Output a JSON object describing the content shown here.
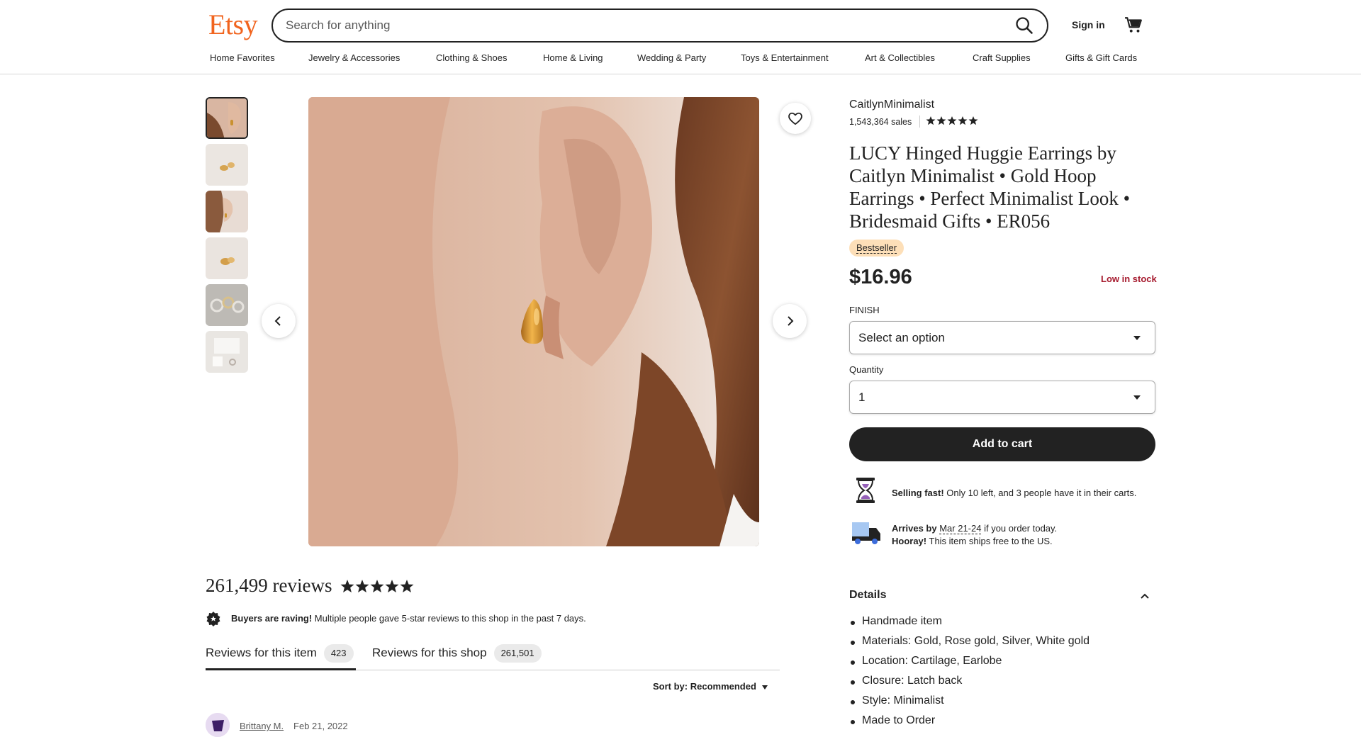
{
  "header": {
    "logo": "Etsy",
    "search_placeholder": "Search for anything",
    "sign_in": "Sign in",
    "nav": [
      "Home Favorites",
      "Jewelry & Accessories",
      "Clothing & Shoes",
      "Home & Living",
      "Wedding & Party",
      "Toys & Entertainment",
      "Art & Collectibles",
      "Craft Supplies",
      "Gifts & Gift Cards"
    ]
  },
  "gallery": {
    "thumbnail_count": 6,
    "active_index": 0
  },
  "product": {
    "shop_name": "CaitlynMinimalist",
    "sales": "1,543,364 sales",
    "shop_rating_stars": 5,
    "title": "LUCY Hinged Huggie Earrings by Caitlyn Minimalist • Gold Hoop Earrings • Perfect Minimalist Look • Bridesmaid Gifts • ER056",
    "badge": "Bestseller",
    "price": "$16.96",
    "stock": "Low in stock",
    "finish_label": "FINISH",
    "finish_value": "Select an option",
    "quantity_label": "Quantity",
    "quantity_value": "1",
    "add_to_cart": "Add to cart",
    "selling_fast_bold": "Selling fast!",
    "selling_fast_text": " Only 10 left, and 3 people have it in their carts.",
    "arrives_bold": "Arrives by",
    "arrives_date": "Mar 21-24",
    "arrives_text": " if you order today.",
    "hooray_bold": "Hooray!",
    "hooray_text": " This item ships free to the US."
  },
  "details": {
    "title": "Details",
    "items": [
      "Handmade item",
      "Materials: Gold, Rose gold, Silver, White gold",
      "Location: Cartilage, Earlobe",
      "Closure: Latch back",
      "Style: Minimalist",
      "Made to Order"
    ]
  },
  "reviews": {
    "count": "261,499 reviews",
    "stars": 5,
    "raving_bold": "Buyers are raving!",
    "raving_text": " Multiple people gave 5-star reviews to this shop in the past 7 days.",
    "tab_item_label": "Reviews for this item",
    "tab_item_count": "423",
    "tab_shop_label": "Reviews for this shop",
    "tab_shop_count": "261,501",
    "sort_label": "Sort by: Recommended",
    "first_reviewer": "Brittany M.",
    "first_date": "Feb 21, 2022"
  },
  "colors": {
    "brand": "#f1641e",
    "stock_red": "#a61a2e",
    "badge_bg": "#fddfb8",
    "button_dark": "#222222"
  }
}
